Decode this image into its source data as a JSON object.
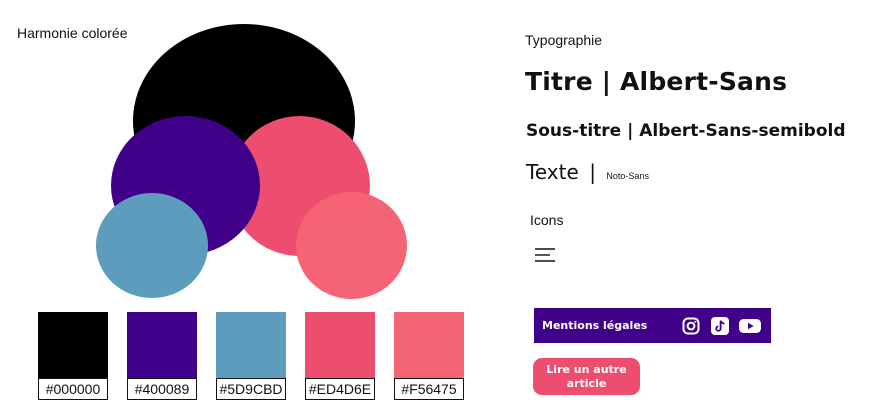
{
  "palette": {
    "title": "Harmonie colorée",
    "colors": [
      {
        "hex": "#000000",
        "label": "#000000"
      },
      {
        "hex": "#400089",
        "label": "#400089"
      },
      {
        "hex": "#5D9CBD",
        "label": "#5D9CBD"
      },
      {
        "hex": "#ED4D6E",
        "label": "#ED4D6E"
      },
      {
        "hex": "#F56475",
        "label": "#F56475"
      }
    ]
  },
  "typography": {
    "heading": "Typographie",
    "title_sample": "Titre | Albert-Sans",
    "subtitle_sample": "Sous-titre | Albert-Sans-semibold",
    "text_sample": "Texte",
    "text_separator": "|",
    "text_font": "Noto-Sans"
  },
  "icons": {
    "heading": "Icons",
    "menu_icon": "hamburger-menu-icon"
  },
  "footer": {
    "label": "Mentions légales",
    "background": "#400089",
    "social_icons": [
      "instagram-icon",
      "tiktok-icon",
      "youtube-icon"
    ]
  },
  "cta": {
    "label_line1": "Lire un autre",
    "label_line2": "article",
    "background": "#ED4D6E"
  }
}
